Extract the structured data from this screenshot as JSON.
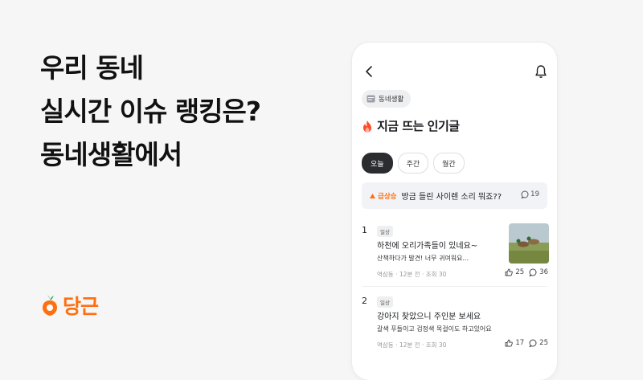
{
  "headline": {
    "line1": "우리 동네",
    "line2": "실시간 이슈 랭킹은?",
    "line3": "동네생활에서"
  },
  "logo": {
    "text": "당근",
    "color": "#ff6f0f"
  },
  "phone": {
    "category_chip": "동네생활",
    "section_title": "지금 뜨는 인기글",
    "tabs": [
      {
        "label": "오늘",
        "active": true
      },
      {
        "label": "주간",
        "active": false
      },
      {
        "label": "월간",
        "active": false
      }
    ],
    "rising": {
      "badge": "급상승",
      "title": "방금 들린 사이렌 소리 뭐죠??",
      "comments": "19"
    },
    "posts": [
      {
        "rank": "1",
        "tag": "일상",
        "title": "하천에 오리가족들이 있네요~",
        "snippet": "산책하다가 발견! 너무 귀여워요...",
        "meta": "역삼동 · 12분 전 · 조회 30",
        "likes": "25",
        "comments": "36",
        "thumbnail": "ducks-on-grass"
      },
      {
        "rank": "2",
        "tag": "일상",
        "title": "강아지 찾았으니 주인분 보세요",
        "snippet": "갈색 푸들이고 검정색 목걸이도 하고있어요",
        "meta": "역삼동 · 12분 전 · 조회 30",
        "likes": "17",
        "comments": "25"
      }
    ]
  },
  "colors": {
    "accent": "#ff6f0f",
    "active_tab": "#2a2c30",
    "rising_bg": "#f2f3f6"
  }
}
